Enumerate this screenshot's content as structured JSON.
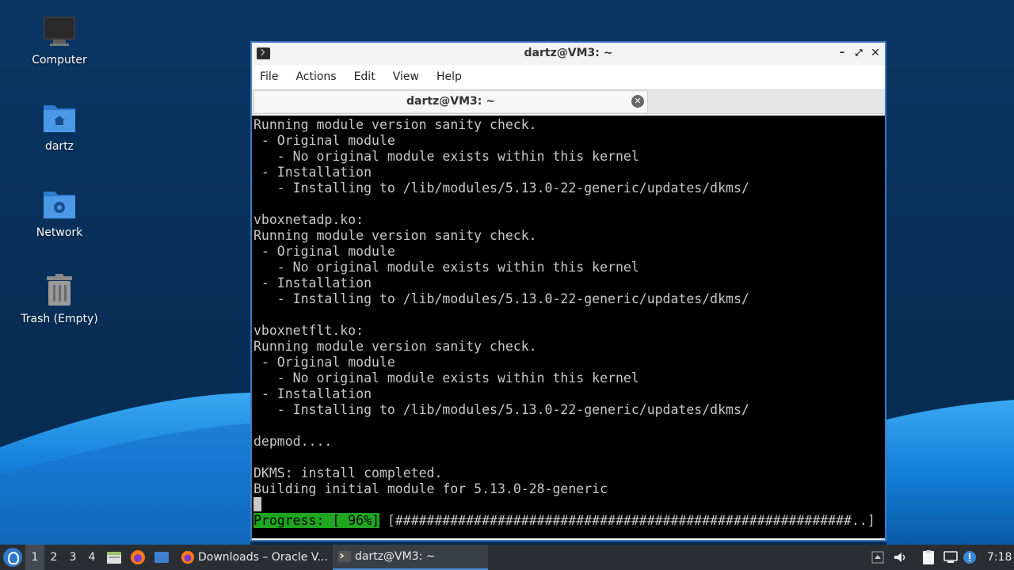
{
  "desktop": {
    "icons": [
      {
        "label": "Computer",
        "icon": "monitor-icon"
      },
      {
        "label": "dartz",
        "icon": "home-folder-icon"
      },
      {
        "label": "Network",
        "icon": "network-folder-icon"
      },
      {
        "label": "Trash (Empty)",
        "icon": "trash-icon"
      }
    ]
  },
  "window": {
    "title": "dartz@VM3: ~",
    "menu": [
      "File",
      "Actions",
      "Edit",
      "View",
      "Help"
    ],
    "tab_label": "dartz@VM3: ~",
    "terminal_lines": [
      "Running module version sanity check.",
      " - Original module",
      "   - No original module exists within this kernel",
      " - Installation",
      "   - Installing to /lib/modules/5.13.0-22-generic/updates/dkms/",
      "",
      "vboxnetadp.ko:",
      "Running module version sanity check.",
      " - Original module",
      "   - No original module exists within this kernel",
      " - Installation",
      "   - Installing to /lib/modules/5.13.0-22-generic/updates/dkms/",
      "",
      "vboxnetflt.ko:",
      "Running module version sanity check.",
      " - Original module",
      "   - No original module exists within this kernel",
      " - Installation",
      "   - Installing to /lib/modules/5.13.0-22-generic/updates/dkms/",
      "",
      "depmod....",
      "",
      "DKMS: install completed.",
      "Building initial module for 5.13.0-28-generic"
    ],
    "progress_label": "Progress: [ 96%]",
    "progress_bar": " [##########################################################..]",
    "progress_percent": 96
  },
  "taskbar": {
    "workspaces": [
      "1",
      "2",
      "3",
      "4"
    ],
    "active_workspace": "1",
    "tasks": [
      {
        "label": "Downloads – Oracle V...",
        "icon": "firefox-icon"
      },
      {
        "label": "dartz@VM3: ~",
        "icon": "terminal-icon"
      }
    ],
    "clock": "7:18"
  },
  "colors": {
    "desktop_bg": "#08305a",
    "wave_light": "#1e8fe6",
    "window_border": "#3d7dc4",
    "progress_green": "#1fa51f"
  }
}
